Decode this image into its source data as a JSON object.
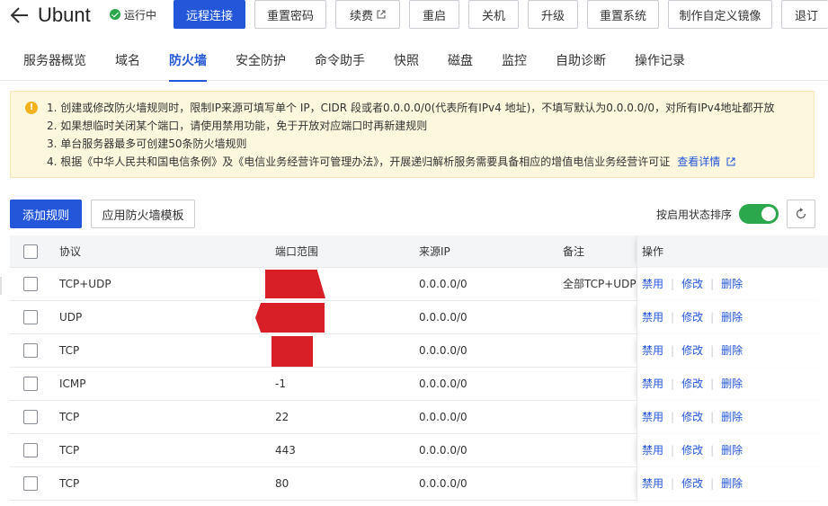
{
  "header": {
    "title": "Ubunt",
    "status": "运行中",
    "buttons": {
      "remote": "远程连接",
      "reset_password": "重置密码",
      "renew": "续费",
      "restart": "重启",
      "shutdown": "关机",
      "upgrade": "升级",
      "reset_system": "重置系统",
      "custom_image": "制作自定义镜像",
      "refund": "退订"
    }
  },
  "tabs": [
    "服务器概览",
    "域名",
    "防火墙",
    "安全防护",
    "命令助手",
    "快照",
    "磁盘",
    "监控",
    "自助诊断",
    "操作记录"
  ],
  "active_tab": "防火墙",
  "notice": {
    "lines": [
      "1. 创建或修改防火墙规则时，限制IP来源可填写单个 IP，CIDR 段或者0.0.0.0/0(代表所有IPv4 地址)，不填写默认为0.0.0.0/0，对所有IPv4地址都开放",
      "2. 如果想临时关闭某个端口，请使用禁用功能，免于开放对应端口时再新建规则",
      "3. 单台服务器最多可创建50条防火墙规则",
      "4. 根据《中华人民共和国电信条例》及《电信业务经营许可管理办法》，开展递归解析服务需要具备相应的增值电信业务经营许可证"
    ],
    "link": "查看详情"
  },
  "toolbar": {
    "add_rule": "添加规则",
    "apply_template": "应用防火墙模板",
    "sort_label": "按启用状态排序"
  },
  "table": {
    "headers": {
      "protocol": "协议",
      "port": "端口范围",
      "source": "来源IP",
      "remark": "备注",
      "ops": "操作"
    },
    "ops": {
      "disable": "禁用",
      "edit": "修改",
      "delete": "删除"
    },
    "rows": [
      {
        "protocol": "TCP+UDP",
        "port": "",
        "source": "0.0.0.0/0",
        "remark": "全部TCP+UDP"
      },
      {
        "protocol": "UDP",
        "port": "",
        "source": "0.0.0.0/0",
        "remark": ""
      },
      {
        "protocol": "TCP",
        "port": "",
        "source": "0.0.0.0/0",
        "remark": ""
      },
      {
        "protocol": "ICMP",
        "port": "-1",
        "source": "0.0.0.0/0",
        "remark": ""
      },
      {
        "protocol": "TCP",
        "port": "22",
        "source": "0.0.0.0/0",
        "remark": ""
      },
      {
        "protocol": "TCP",
        "port": "443",
        "source": "0.0.0.0/0",
        "remark": ""
      },
      {
        "protocol": "TCP",
        "port": "80",
        "source": "0.0.0.0/0",
        "remark": ""
      }
    ]
  },
  "colors": {
    "primary": "#2356d8",
    "success": "#2ca84c",
    "notice_bg": "#fdf7dd",
    "redaction": "#d81e26"
  },
  "icons": [
    "arrow-left-icon",
    "check-circle-icon",
    "external-link-icon",
    "warning-icon",
    "refresh-icon"
  ]
}
